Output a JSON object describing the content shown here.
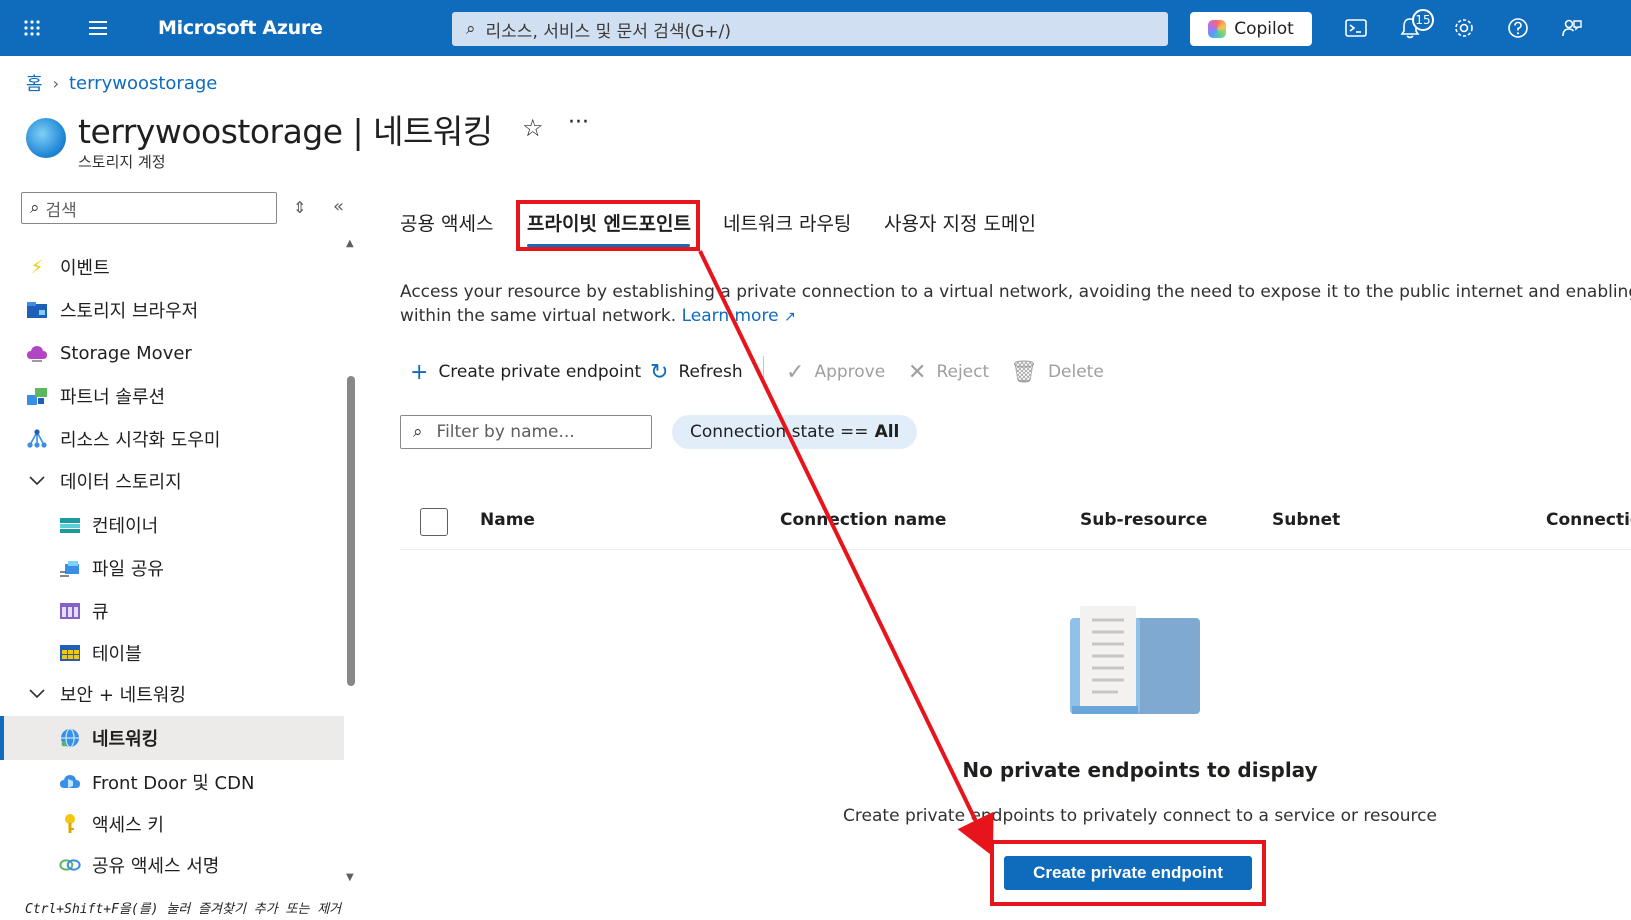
{
  "topbar": {
    "brand": "Microsoft Azure",
    "search_placeholder": "리소스, 서비스 및 문서 검색(G+/)",
    "copilot_label": "Copilot",
    "notification_count": "15",
    "accent": "#0f6cbd"
  },
  "breadcrumb": {
    "home": "홈",
    "resource": "terrywoostorage"
  },
  "header": {
    "title": "terrywoostorage | 네트워킹",
    "subtitle": "스토리지 계정"
  },
  "sidebar": {
    "search_placeholder": "검색",
    "hint": "Ctrl+Shift+F을(를) 눌러 즐겨찾기 추가 또는 제거",
    "items": [
      {
        "label": "이벤트",
        "icon": "lightning-icon"
      },
      {
        "label": "스토리지 브라우저",
        "icon": "storage-browser-icon"
      },
      {
        "label": "Storage Mover",
        "icon": "cloud-icon"
      },
      {
        "label": "파트너 솔루션",
        "icon": "partner-icon"
      },
      {
        "label": "리소스 시각화 도우미",
        "icon": "visualizer-icon"
      },
      {
        "label": "데이터 스토리지",
        "icon": "chevron-down-icon"
      },
      {
        "label": "컨테이너",
        "icon": "container-icon"
      },
      {
        "label": "파일 공유",
        "icon": "file-share-icon"
      },
      {
        "label": "큐",
        "icon": "queue-icon"
      },
      {
        "label": "테이블",
        "icon": "table-icon"
      },
      {
        "label": "보안 + 네트워킹",
        "icon": "chevron-down-icon"
      },
      {
        "label": "네트워킹",
        "icon": "networking-icon"
      },
      {
        "label": "Front Door 및 CDN",
        "icon": "front-door-icon"
      },
      {
        "label": "액세스 키",
        "icon": "key-icon"
      },
      {
        "label": "공유 액세스 서명",
        "icon": "link-icon"
      }
    ]
  },
  "tabs": [
    {
      "label": "공용 액세스"
    },
    {
      "label": "프라이빗 엔드포인트"
    },
    {
      "label": "네트워크 라우팅"
    },
    {
      "label": "사용자 지정 도메인"
    }
  ],
  "description": {
    "text": "Access your resource by establishing a private connection to a virtual network, avoiding the need to expose it to the public internet and enabling communica",
    "text2": "within the same virtual network.",
    "link": "Learn more"
  },
  "toolbar": {
    "create": "Create private endpoint",
    "refresh": "Refresh",
    "approve": "Approve",
    "reject": "Reject",
    "delete": "Delete"
  },
  "filter": {
    "placeholder": "Filter by name...",
    "pill_prefix": "Connection state ==",
    "pill_value": "All"
  },
  "table": {
    "columns": [
      "Name",
      "Connection name",
      "Sub-resource",
      "Subnet",
      "Connectio"
    ]
  },
  "empty": {
    "title": "No private endpoints to display",
    "subtitle": "Create private endpoints to privately connect to a service or resource",
    "button": "Create private endpoint"
  },
  "highlight_color": "#e8141c"
}
